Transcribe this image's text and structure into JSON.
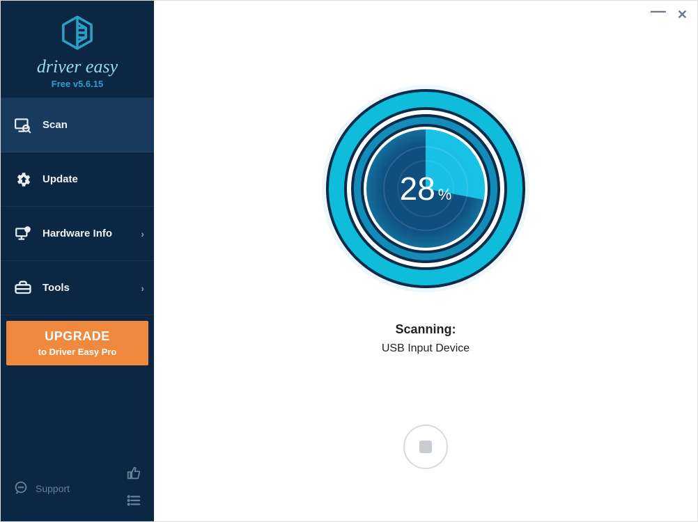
{
  "brand": {
    "name": "driver easy",
    "version": "Free v5.6.15"
  },
  "sidebar": {
    "items": [
      {
        "label": "Scan",
        "icon": "scan-icon",
        "has_chevron": false,
        "active": true
      },
      {
        "label": "Update",
        "icon": "update-icon",
        "has_chevron": false,
        "active": false
      },
      {
        "label": "Hardware Info",
        "icon": "hardware-icon",
        "has_chevron": true,
        "active": false
      },
      {
        "label": "Tools",
        "icon": "tools-icon",
        "has_chevron": true,
        "active": false
      }
    ],
    "upgrade": {
      "title": "UPGRADE",
      "subtitle": "to Driver Easy Pro"
    },
    "support_label": "Support"
  },
  "scan": {
    "percent": 28,
    "percent_deg": 100.8,
    "title": "Scanning:",
    "device": "USB Input Device"
  },
  "colors": {
    "ring_dark": "#0a2b4b",
    "ring_dark2": "#0d3a63",
    "ring_cyan": "#0fbcd9",
    "ring_cyan_light": "#26dff0",
    "fill_dark": "#0f4f7f",
    "fill_bright": "#17b9e0"
  }
}
